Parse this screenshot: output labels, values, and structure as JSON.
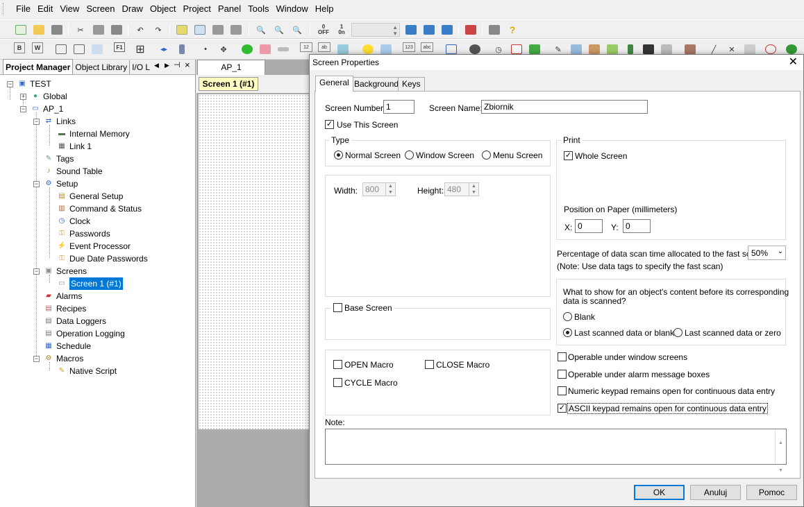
{
  "menu": [
    "File",
    "Edit",
    "View",
    "Screen",
    "Draw",
    "Object",
    "Project",
    "Panel",
    "Tools",
    "Window",
    "Help"
  ],
  "toolbar": {
    "off_label": "OFF",
    "on_label": "0n",
    "off_num": "0",
    "on_num": "1"
  },
  "left_panel": {
    "tabs": [
      "Project Manager",
      "Object Library",
      "I/O L"
    ],
    "tree": {
      "test": "TEST",
      "global": "Global",
      "ap1": "AP_1",
      "links": "Links",
      "internal_memory": "Internal Memory",
      "link1": "Link 1",
      "tags": "Tags",
      "sound_table": "Sound Table",
      "setup": "Setup",
      "general_setup": "General Setup",
      "command_status": "Command & Status",
      "clock": "Clock",
      "passwords": "Passwords",
      "event_processor": "Event Processor",
      "due_date_passwords": "Due Date Passwords",
      "screens": "Screens",
      "screen1": "Screen 1 (#1)",
      "alarms": "Alarms",
      "recipes": "Recipes",
      "data_loggers": "Data Loggers",
      "operation_logging": "Operation Logging",
      "schedule": "Schedule",
      "macros": "Macros",
      "native_script": "Native Script"
    }
  },
  "doc": {
    "tab": "AP_1",
    "screen_tab": "Screen 1 (#1)"
  },
  "dialog": {
    "title": "Screen Properties",
    "tabs": [
      "General",
      "Background",
      "Keys"
    ],
    "screen_number_label": "Screen Number:",
    "screen_number": "1",
    "screen_name_label": "Screen Name:",
    "screen_name": "Zbiornik",
    "use_this_screen": "Use This Screen",
    "type_label": "Type",
    "normal_screen": "Normal Screen",
    "window_screen": "Window Screen",
    "menu_screen": "Menu Screen",
    "width_label": "Width:",
    "width": "800",
    "height_label": "Height:",
    "height": "480",
    "base_screen": "Base Screen",
    "open_macro": "OPEN Macro",
    "close_macro": "CLOSE Macro",
    "cycle_macro": "CYCLE Macro",
    "print_label": "Print",
    "whole_screen": "Whole Screen",
    "position_label": "Position on Paper (millimeters)",
    "x_label": "X:",
    "x_value": "0",
    "y_label": "Y:",
    "y_value": "0",
    "fast_scan_label": "Percentage of data scan time allocated to the fast scan:",
    "fast_scan_value": "50%",
    "fast_scan_note": "(Note: Use data tags to specify the fast scan)",
    "show_label_1": "What to show for an object's content before its corresponding",
    "show_label_2": "data is scanned?",
    "blank": "Blank",
    "last_or_blank": "Last scanned data or blank",
    "last_or_zero": "Last scanned data or zero",
    "operable_window": "Operable under window screens",
    "operable_alarm": "Operable under alarm message boxes",
    "numeric_keypad": "Numeric keypad remains open for continuous data entry",
    "ascii_keypad": "ASCII keypad remains open for continuous data entry",
    "note_label": "Note:",
    "ok": "OK",
    "cancel": "Anuluj",
    "help": "Pomoc"
  }
}
